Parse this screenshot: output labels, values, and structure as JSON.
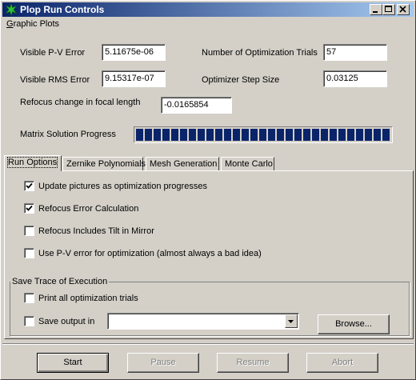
{
  "window": {
    "title": "Plop Run Controls"
  },
  "menu": {
    "graphic_plots_u": "G",
    "graphic_plots_rest": "raphic Plots"
  },
  "fields": {
    "visible_pv_error": {
      "label": "Visible P-V Error",
      "value": "5.11675e-06"
    },
    "num_opt_trials": {
      "label": "Number of Optimization Trials",
      "value": "57"
    },
    "visible_rms_error": {
      "label": "Visible RMS Error",
      "value": "9.15317e-07"
    },
    "optimizer_step_size": {
      "label": "Optimizer Step Size",
      "value": "0.03125"
    },
    "refocus_change": {
      "label": "Refocus change in focal length",
      "value": "-0.0165854"
    }
  },
  "progress": {
    "label": "Matrix Solution Progress",
    "value_fraction": 1.0
  },
  "tabs": [
    "Run Options",
    "Zernike Polynomials",
    "Mesh Generation",
    "Monte Carlo"
  ],
  "options": [
    {
      "label": "Update pictures as optimization progresses",
      "checked": true
    },
    {
      "label": "Refocus Error Calculation",
      "checked": true
    },
    {
      "label": "Refocus Includes Tilt in Mirror",
      "checked": false
    },
    {
      "label": "Use P-V error for optimization (almost always a bad idea)",
      "checked": false
    }
  ],
  "trace": {
    "title": "Save Trace of Execution",
    "print_trials": {
      "label": "Print all optimization trials",
      "checked": false
    },
    "save_output": {
      "label": "Save output in",
      "checked": false,
      "value": ""
    },
    "browse_label": "Browse..."
  },
  "buttons": {
    "start": "Start",
    "pause": "Pause",
    "resume": "Resume",
    "abort": "Abort"
  },
  "colors": {
    "titlebar_start": "#0a246a",
    "titlebar_end": "#a6caf0",
    "progress": "#0a246a",
    "face": "#d4d0c8"
  }
}
